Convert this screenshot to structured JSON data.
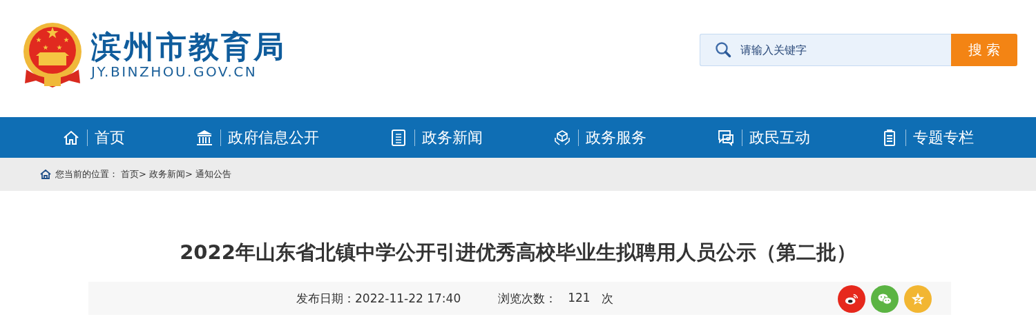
{
  "header": {
    "site_name": "滨州市教育局",
    "domain": "JY.BINZHOU.GOV.CN"
  },
  "search": {
    "placeholder": "请输入关键字",
    "button": "搜 索"
  },
  "nav": [
    {
      "label": "首页",
      "kind": "home"
    },
    {
      "label": "政府信息公开",
      "kind": "building"
    },
    {
      "label": "政务新闻",
      "kind": "document"
    },
    {
      "label": "政务服务",
      "kind": "service"
    },
    {
      "label": "政民互动",
      "kind": "chat"
    },
    {
      "label": "专题专栏",
      "kind": "list"
    }
  ],
  "breadcrumb": {
    "label": "您当前的位置：",
    "items": [
      "首页>",
      "政务新闻>",
      "通知公告"
    ]
  },
  "article": {
    "title": "2022年山东省北镇中学公开引进优秀高校毕业生拟聘用人员公示（第二批）",
    "date": "发布日期：2022-11-22 17:40",
    "views_label": "浏览次数：",
    "views": "121",
    "views_unit": "次"
  },
  "share": [
    {
      "kind": "weibo",
      "color": "#e6281c"
    },
    {
      "kind": "wechat",
      "color": "#5bb443"
    },
    {
      "kind": "qzone",
      "color": "#f2b632"
    }
  ]
}
